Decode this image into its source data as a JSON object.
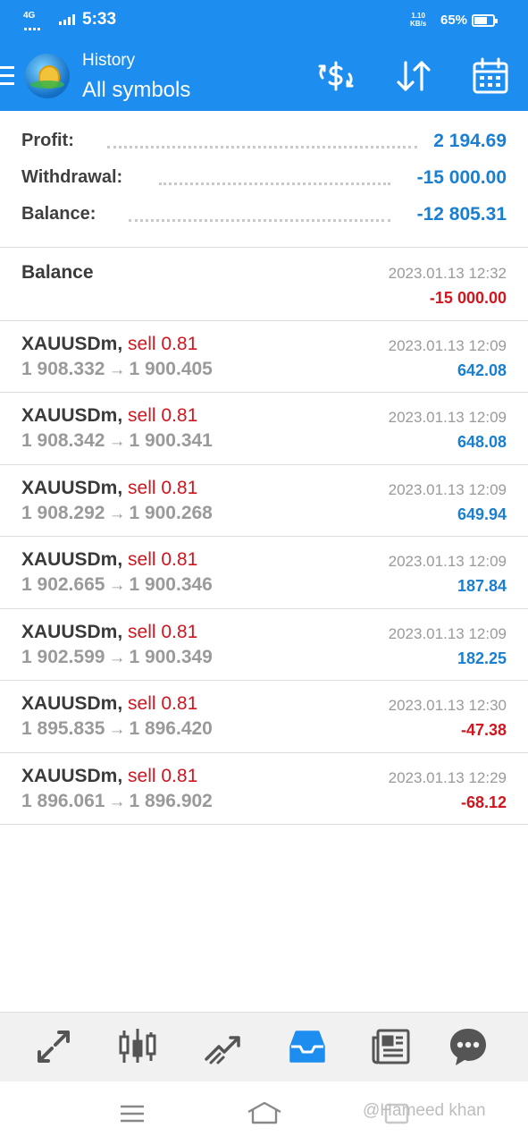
{
  "status_bar": {
    "network": "4G",
    "time": "5:33",
    "speed_value": "1.10",
    "speed_unit": "KB/s",
    "battery": "65%"
  },
  "header": {
    "subtitle": "History",
    "title": "All symbols",
    "icons": [
      "menu-icon",
      "app-logo",
      "deposit-exchange-icon",
      "sort-icon",
      "calendar-icon"
    ]
  },
  "summary": {
    "profit_label": "Profit:",
    "profit_value": "2 194.69",
    "withdrawal_label": "Withdrawal:",
    "withdrawal_value": "-15 000.00",
    "balance_label": "Balance:",
    "balance_value": "-12 805.31"
  },
  "balance_entry": {
    "label": "Balance",
    "time": "2023.01.13 12:32",
    "amount": "-15 000.00"
  },
  "deals": [
    {
      "symbol": "XAUUSDm,",
      "side": "sell 0.81",
      "open": "1 908.332",
      "arrow": "→",
      "close": "1 900.405",
      "time": "2023.01.13 12:09",
      "profit": "642.08"
    },
    {
      "symbol": "XAUUSDm,",
      "side": "sell 0.81",
      "open": "1 908.342",
      "arrow": "→",
      "close": "1 900.341",
      "time": "2023.01.13 12:09",
      "profit": "648.08"
    },
    {
      "symbol": "XAUUSDm,",
      "side": "sell 0.81",
      "open": "1 908.292",
      "arrow": "→",
      "close": "1 900.268",
      "time": "2023.01.13 12:09",
      "profit": "649.94"
    },
    {
      "symbol": "XAUUSDm,",
      "side": "sell 0.81",
      "open": "1 902.665",
      "arrow": "→",
      "close": "1 900.346",
      "time": "2023.01.13 12:09",
      "profit": "187.84"
    },
    {
      "symbol": "XAUUSDm,",
      "side": "sell 0.81",
      "open": "1 902.599",
      "arrow": "→",
      "close": "1 900.349",
      "time": "2023.01.13 12:09",
      "profit": "182.25"
    },
    {
      "symbol": "XAUUSDm,",
      "side": "sell 0.81",
      "open": "1 895.835",
      "arrow": "→",
      "close": "1 896.420",
      "time": "2023.01.13 12:30",
      "profit": "-47.38"
    },
    {
      "symbol": "XAUUSDm,",
      "side": "sell 0.81",
      "open": "1 896.061",
      "arrow": "→",
      "close": "1 896.902",
      "time": "2023.01.13 12:29",
      "profit": "-68.12"
    }
  ],
  "tabbar": {
    "tabs": [
      "quotes-icon",
      "chart-icon",
      "trade-icon",
      "history-icon",
      "news-icon",
      "messages-icon"
    ],
    "active": "history-icon",
    "active_color": "#1d8df0",
    "inactive_color": "#555555"
  },
  "system_nav": {
    "buttons": [
      "recents-icon",
      "home-icon",
      "back-icon"
    ],
    "watermark": "@Hameed khan"
  },
  "colors": {
    "accent": "#1d8df0",
    "profit_positive": "#1a7fd0",
    "profit_negative": "#d0161f"
  }
}
